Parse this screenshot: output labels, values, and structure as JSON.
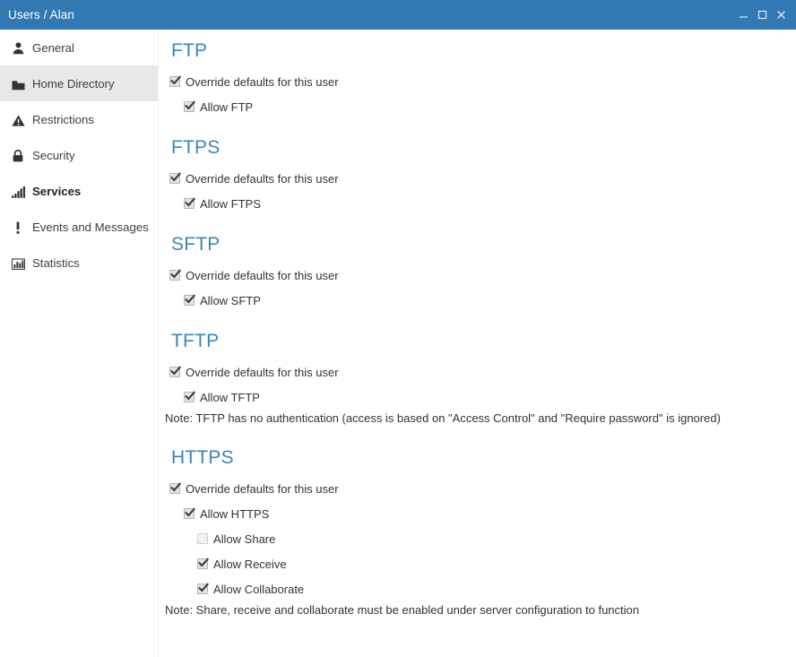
{
  "window": {
    "title": "Users / Alan",
    "titlebar_color": "#3279b3",
    "controls": {
      "minimize": "minimize-icon",
      "maximize": "maximize-icon",
      "close": "close-icon"
    }
  },
  "sidebar": {
    "items": [
      {
        "label": "General",
        "icon": "user-icon",
        "state": "normal"
      },
      {
        "label": "Home Directory",
        "icon": "folder-icon",
        "state": "hover"
      },
      {
        "label": "Restrictions",
        "icon": "warning-icon",
        "state": "normal"
      },
      {
        "label": "Security",
        "icon": "lock-icon",
        "state": "normal"
      },
      {
        "label": "Services",
        "icon": "signal-bars-icon",
        "state": "current"
      },
      {
        "label": "Events and Messages",
        "icon": "exclamation-icon",
        "state": "normal"
      },
      {
        "label": "Statistics",
        "icon": "bar-chart-icon",
        "state": "normal"
      }
    ]
  },
  "main": {
    "accent_color": "#3b86b4",
    "sections": [
      {
        "title": "FTP",
        "options": [
          {
            "label": "Override defaults for this user",
            "checked": true,
            "level": 0
          },
          {
            "label": "Allow FTP",
            "checked": true,
            "level": 1
          }
        ],
        "note": ""
      },
      {
        "title": "FTPS",
        "options": [
          {
            "label": "Override defaults for this user",
            "checked": true,
            "level": 0
          },
          {
            "label": "Allow FTPS",
            "checked": true,
            "level": 1
          }
        ],
        "note": ""
      },
      {
        "title": "SFTP",
        "options": [
          {
            "label": "Override defaults for this user",
            "checked": true,
            "level": 0
          },
          {
            "label": "Allow SFTP",
            "checked": true,
            "level": 1
          }
        ],
        "note": ""
      },
      {
        "title": "TFTP",
        "options": [
          {
            "label": "Override defaults for this user",
            "checked": true,
            "level": 0
          },
          {
            "label": "Allow TFTP",
            "checked": true,
            "level": 1
          }
        ],
        "note": "Note: TFTP has no authentication (access is based on \"Access Control\" and \"Require password\" is ignored)"
      },
      {
        "title": "HTTPS",
        "options": [
          {
            "label": "Override defaults for this user",
            "checked": true,
            "level": 0
          },
          {
            "label": "Allow HTTPS",
            "checked": true,
            "level": 1
          },
          {
            "label": "Allow Share",
            "checked": false,
            "level": 2
          },
          {
            "label": "Allow Receive",
            "checked": true,
            "level": 2
          },
          {
            "label": "Allow Collaborate",
            "checked": true,
            "level": 2
          }
        ],
        "note": "Note: Share, receive and collaborate must be enabled under server configuration to function"
      }
    ]
  }
}
